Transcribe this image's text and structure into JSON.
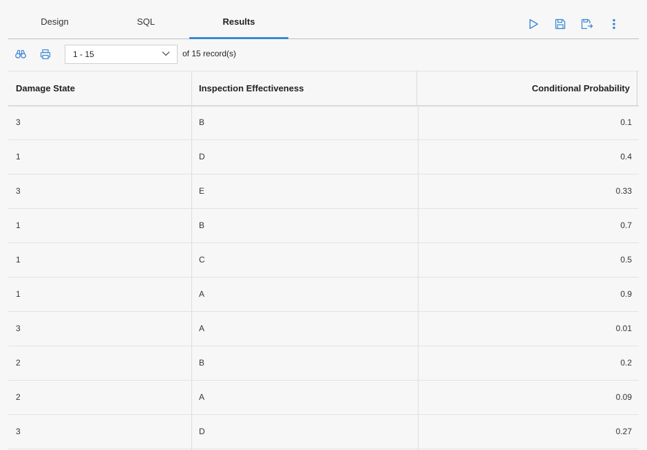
{
  "tabs": [
    {
      "label": "Design",
      "active": false
    },
    {
      "label": "SQL",
      "active": false
    },
    {
      "label": "Results",
      "active": true
    }
  ],
  "toolbar": {
    "icons": [
      "run-icon",
      "save-icon",
      "save-as-icon",
      "more-icon"
    ]
  },
  "results_toolbar": {
    "find_icon": "binoculars-icon",
    "print_icon": "print-icon",
    "pager_value": "1 - 15",
    "record_count_text": "of 15 record(s)"
  },
  "table": {
    "columns": [
      "Damage State",
      "Inspection Effectiveness",
      "Conditional Probability"
    ],
    "rows": [
      [
        "3",
        "B",
        "0.1"
      ],
      [
        "1",
        "D",
        "0.4"
      ],
      [
        "3",
        "E",
        "0.33"
      ],
      [
        "1",
        "B",
        "0.7"
      ],
      [
        "1",
        "C",
        "0.5"
      ],
      [
        "1",
        "A",
        "0.9"
      ],
      [
        "3",
        "A",
        "0.01"
      ],
      [
        "2",
        "B",
        "0.2"
      ],
      [
        "2",
        "A",
        "0.09"
      ],
      [
        "3",
        "D",
        "0.27"
      ]
    ]
  },
  "colors": {
    "accent": "#3b87d6",
    "icon": "#3b87d6"
  }
}
